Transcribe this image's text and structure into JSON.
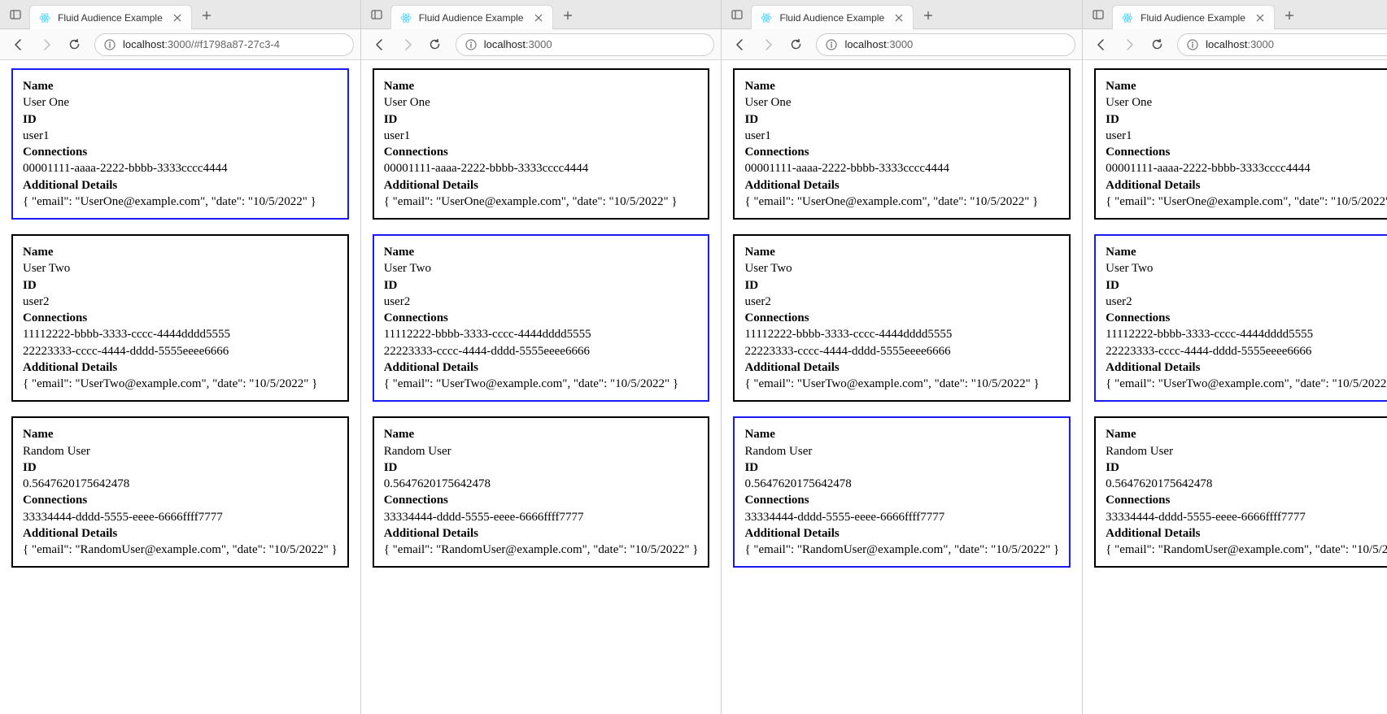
{
  "windows": [
    {
      "tab_title": "Fluid Audience Example",
      "url_display": "localhost:3000/#f1798a87-27c3-4",
      "url_host": "localhost",
      "url_rest": ":3000/#f1798a87-27c3-4",
      "selected_index": 0
    },
    {
      "tab_title": "Fluid Audience Example",
      "url_display": "localhost:3000",
      "url_host": "localhost",
      "url_rest": ":3000",
      "selected_index": 1
    },
    {
      "tab_title": "Fluid Audience Example",
      "url_display": "localhost:3000",
      "url_host": "localhost",
      "url_rest": ":3000",
      "selected_index": 2
    },
    {
      "tab_title": "Fluid Audience Example",
      "url_display": "localhost:3000",
      "url_host": "localhost",
      "url_rest": ":3000",
      "selected_index": 1
    }
  ],
  "labels": {
    "name": "Name",
    "id": "ID",
    "connections": "Connections",
    "details": "Additional Details"
  },
  "users": [
    {
      "name": "User One",
      "id": "user1",
      "connections": [
        "00001111-aaaa-2222-bbbb-3333cccc4444"
      ],
      "details": "{ \"email\": \"UserOne@example.com\", \"date\": \"10/5/2022\" }"
    },
    {
      "name": "User Two",
      "id": "user2",
      "connections": [
        "11112222-bbbb-3333-cccc-4444dddd5555",
        "22223333-cccc-4444-dddd-5555eeee6666"
      ],
      "details": "{ \"email\": \"UserTwo@example.com\", \"date\": \"10/5/2022\" }"
    },
    {
      "name": "Random User",
      "id": "0.5647620175642478",
      "connections": [
        "33334444-dddd-5555-eeee-6666ffff7777"
      ],
      "details": "{ \"email\": \"RandomUser@example.com\", \"date\": \"10/5/2022\" }"
    }
  ]
}
